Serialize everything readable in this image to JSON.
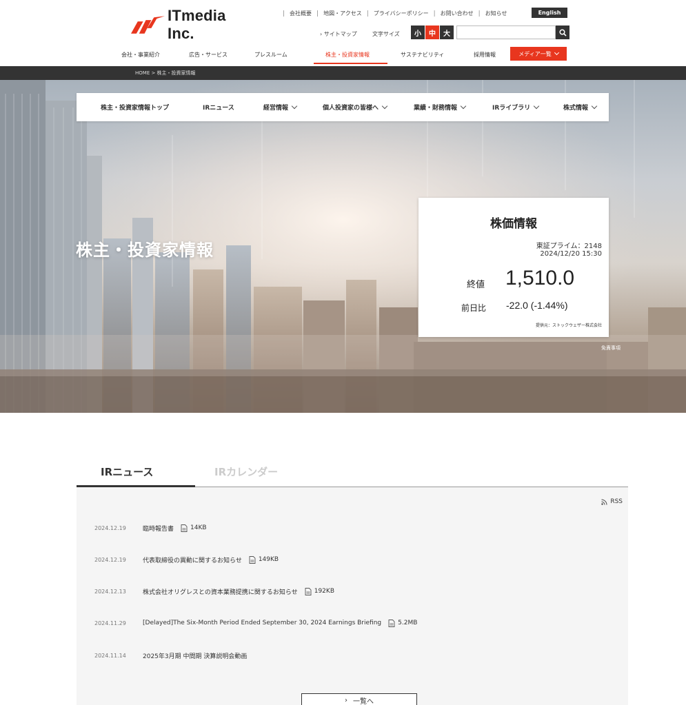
{
  "header": {
    "logo_text": "ITmedia Inc.",
    "util_links": [
      "会社概要",
      "地図・アクセス",
      "プライバシーポリシー",
      "お問い合わせ",
      "お知らせ"
    ],
    "english_label": "English",
    "sitemap_label": "サイトマップ",
    "fontsize_label": "文字サイズ",
    "fontsize_small": "小",
    "fontsize_mid": "中",
    "fontsize_large": "大",
    "search_placeholder": ""
  },
  "main_nav": {
    "items": [
      "会社・事業紹介",
      "広告・サービス",
      "プレスルーム",
      "株主・投資家情報",
      "サステナビリティ",
      "採用情報"
    ],
    "media_label": "メディア一覧"
  },
  "breadcrumb": "HOME > 株主・投資家情報",
  "hero": {
    "subnav": [
      "株主・投資家情報トップ",
      "IRニュース",
      "経営情報",
      "個人投資家の皆様へ",
      "業績・財務情報",
      "IRライブラリ",
      "株式情報"
    ],
    "title": "株主・投資家情報",
    "disclaimer": "免責事項"
  },
  "stock": {
    "title": "株価情報",
    "market": "東証プライム：2148",
    "datetime": "2024/12/20 15:30",
    "close_label": "終値",
    "close_value": "1,510.0",
    "change_label": "前日比",
    "change_value": "-22.0 (-1.44%)",
    "provider": "提供元：ストックウェザー株式会社"
  },
  "ir": {
    "tab_news": "IRニュース",
    "tab_calendar": "IRカレンダー",
    "rss_label": "RSS",
    "news": [
      {
        "date": "2024.12.19",
        "title": "臨時報告書",
        "size": "14KB",
        "pdf": true
      },
      {
        "date": "2024.12.19",
        "title": "代表取締役の異動に関するお知らせ",
        "size": "149KB",
        "pdf": true
      },
      {
        "date": "2024.12.13",
        "title": "株式会社オリグレスとの資本業務提携に関するお知らせ",
        "size": "192KB",
        "pdf": true
      },
      {
        "date": "2024.11.29",
        "title": "[Delayed]The Six-Month Period Ended September 30, 2024 Earnings Briefing",
        "size": "5.2MB",
        "pdf": true
      },
      {
        "date": "2024.11.14",
        "title": "2025年3月期 中間期 決算説明会動画",
        "size": "",
        "pdf": false
      }
    ],
    "list_button": "一覧へ"
  },
  "colors": {
    "accent": "#e8361e",
    "dark": "#333333"
  }
}
